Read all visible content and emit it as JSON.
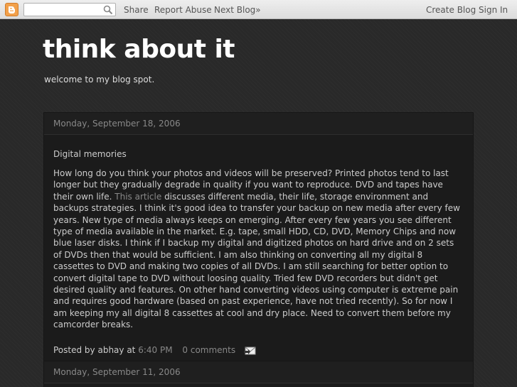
{
  "navbar": {
    "search_placeholder": "",
    "share": "Share",
    "report_abuse": "Report Abuse",
    "next_blog": "Next Blog»",
    "create_blog": "Create Blog",
    "sign_in": "Sign In"
  },
  "header": {
    "title": "think about it",
    "description": "welcome to my blog spot."
  },
  "posts": [
    {
      "date": "Monday, September 18, 2006",
      "title": "Digital memories",
      "body_before_link": "How long do you think your photos and videos will be preserved? Printed photos tend to last longer but they gradually degrade in quality if you want to reproduce. DVD and tapes have their own life. ",
      "link_text": "This article",
      "body_after_link": " discusses different media, their life, storage environment and backups strategies. I think it's good idea to transfer your backup on new media after every few years. New type of media always keeps on emerging. After every few years you see different type of media available in the market. E.g. tape, small HDD, CD, DVD, Memory Chips and now blue laser disks. I think if I backup my digital and digitized photos on hard drive and on 2 sets of DVDs then that would be sufficient. I am also thinking on converting all my digital 8 cassettes to DVD and making two copies of all DVDs. I am still searching for better option to convert digital tape to DVD without loosing quality. Tried few DVD recorders but didn't get desired quality and features. On other hand converting videos using computer is extreme pain and requires good hardware (based on past experience, have not tried recently). So for now I am keeping my all digital 8 cassettes at cool and dry place. Need to convert them before my camcorder breaks.",
      "posted_by_label": "Posted by",
      "author": "abhay",
      "at_label": "at",
      "time": "6:40 PM",
      "comments": "0 comments"
    },
    {
      "date": "Monday, September 11, 2006"
    }
  ],
  "colors": {
    "background": "#292929",
    "card": "#1b1b1b",
    "text": "#cccccc",
    "muted": "#888888",
    "title": "#ffffff"
  },
  "icons": [
    "blogger-logo-icon",
    "search-icon",
    "email-post-icon"
  ]
}
